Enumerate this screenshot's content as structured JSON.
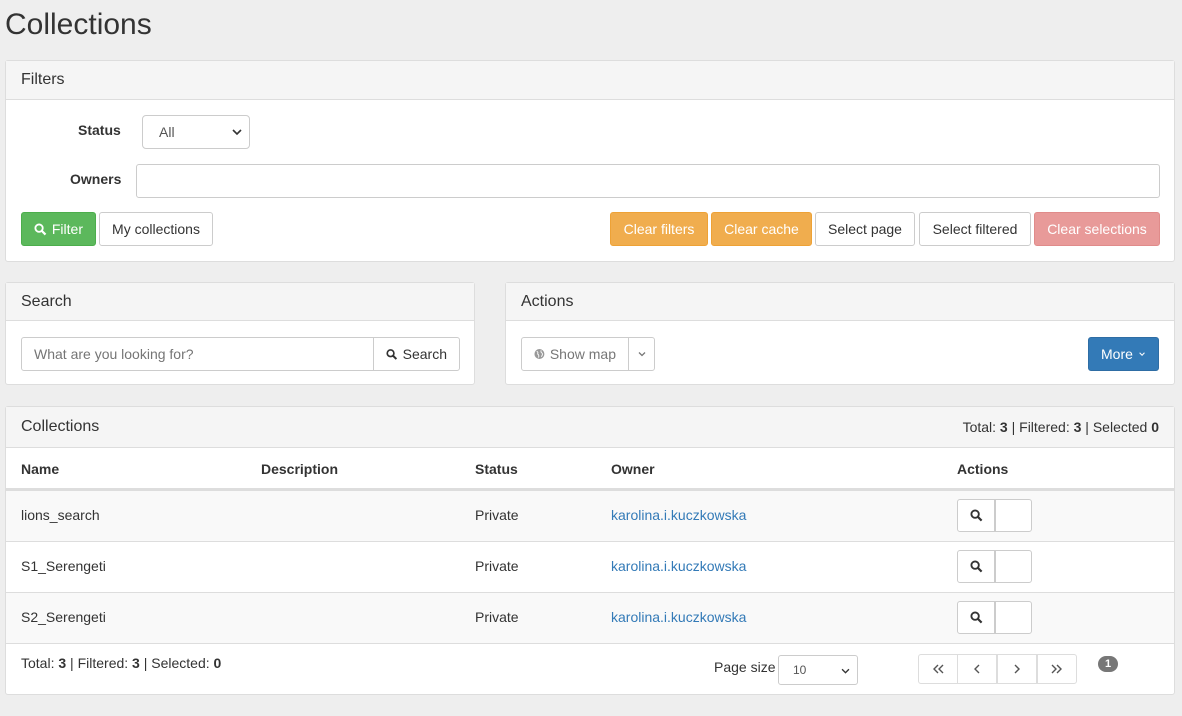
{
  "page": {
    "title": "Collections"
  },
  "filters": {
    "heading": "Filters",
    "status_label": "Status",
    "status_value": "All",
    "owners_label": "Owners",
    "owners_value": "",
    "filter_button": "Filter",
    "my_collections_button": "My collections",
    "clear_filters_button": "Clear filters",
    "clear_cache_button": "Clear cache",
    "select_page_button": "Select page",
    "select_filtered_button": "Select filtered",
    "clear_selections_button": "Clear selections"
  },
  "search": {
    "heading": "Search",
    "placeholder": "What are you looking for?",
    "button": "Search"
  },
  "actions": {
    "heading": "Actions",
    "show_map_button": "Show map",
    "more_button": "More"
  },
  "collections": {
    "heading": "Collections",
    "summary": {
      "total_label": "Total:",
      "total": "3",
      "filtered_label": "Filtered:",
      "filtered": "3",
      "selected_label": "Selected",
      "selected": "0"
    },
    "columns": [
      "Name",
      "Description",
      "Status",
      "Owner",
      "Actions"
    ],
    "rows": [
      {
        "name": "lions_search",
        "description": "",
        "status": "Private",
        "owner": "karolina.i.kuczkowska"
      },
      {
        "name": "S1_Serengeti",
        "description": "",
        "status": "Private",
        "owner": "karolina.i.kuczkowska"
      },
      {
        "name": "S2_Serengeti",
        "description": "",
        "status": "Private",
        "owner": "karolina.i.kuczkowska"
      }
    ],
    "footer": {
      "total_label": "Total:",
      "total": "3",
      "filtered_label": "Filtered:",
      "filtered": "3",
      "selected_label": "Selected:",
      "selected": "0",
      "page_size_label": "Page size",
      "page_size_value": "10",
      "current_page": "1"
    }
  },
  "colors": {
    "success": "#5cb85c",
    "warning": "#f0ad4e",
    "danger": "#d9534f",
    "primary": "#337ab7",
    "link": "#337ab7"
  },
  "icons": {
    "filter": "search-icon",
    "search": "search-icon",
    "show_map": "globe-icon",
    "more": "chevron-down-icon",
    "view": "search-icon",
    "delete": "trash-icon",
    "first": "double-chevron-left-icon",
    "prev": "chevron-left-icon",
    "next": "chevron-right-icon",
    "last": "double-chevron-right-icon"
  }
}
